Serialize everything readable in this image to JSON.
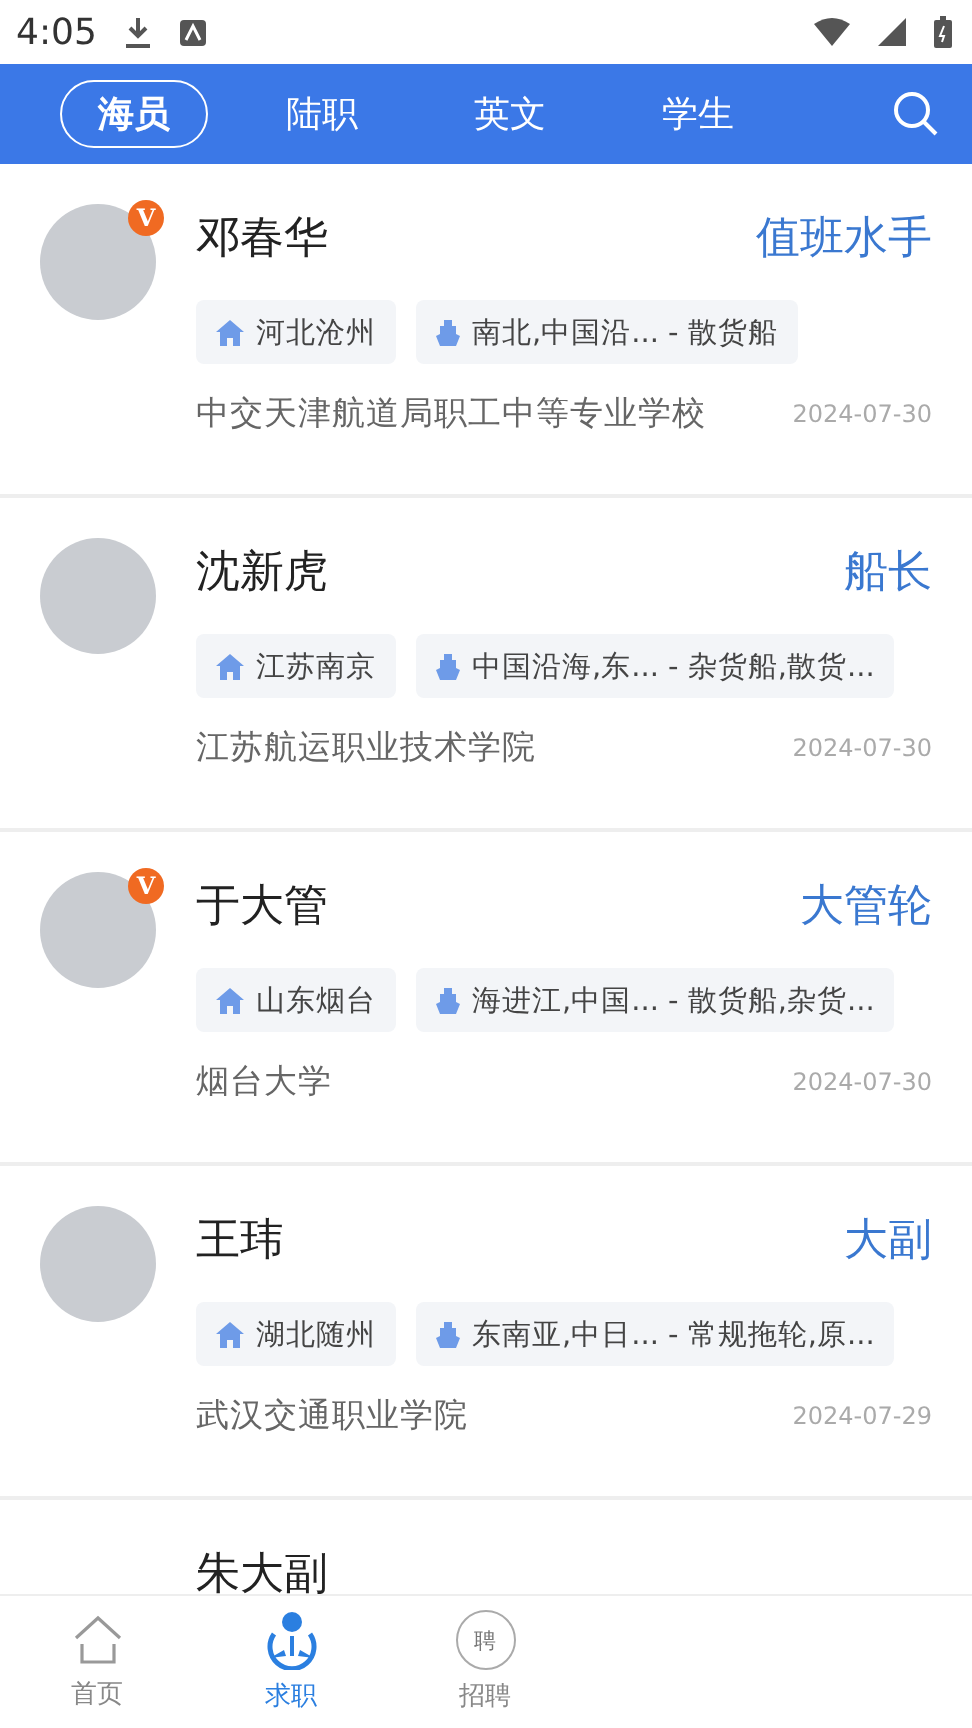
{
  "status_bar": {
    "time": "4:05"
  },
  "tabs": [
    {
      "label": "海员",
      "selected": true
    },
    {
      "label": "陆职",
      "selected": false
    },
    {
      "label": "英文",
      "selected": false
    },
    {
      "label": "学生",
      "selected": false
    }
  ],
  "cards": [
    {
      "name": "邓春华",
      "badge": "V",
      "position": "值班水手",
      "location": "河北沧州",
      "route": "南北,中国沿... - 散货船",
      "school": "中交天津航道局职工中等专业学校",
      "date": "2024-07-30"
    },
    {
      "name": "沈新虎",
      "position": "船长",
      "location": "江苏南京",
      "route": "中国沿海,东... - 杂货船,散货...",
      "school": "江苏航运职业技术学院",
      "date": "2024-07-30"
    },
    {
      "name": "于大管",
      "badge": "V",
      "position": "大管轮",
      "location": "山东烟台",
      "route": "海进江,中国... - 散货船,杂货...",
      "school": "烟台大学",
      "date": "2024-07-30"
    },
    {
      "name": "王玮",
      "position": "大副",
      "location": "湖北随州",
      "route": "东南亚,中日... - 常规拖轮,原...",
      "school": "武汉交通职业学院",
      "date": "2024-07-29"
    },
    {
      "name": "朱大副"
    }
  ],
  "nav": [
    {
      "kind": "home",
      "label": "首页",
      "selected": false
    },
    {
      "kind": "jobs",
      "label": "求职",
      "selected": true
    },
    {
      "kind": "hire",
      "label": "招聘",
      "badge": "聘",
      "selected": false
    }
  ]
}
